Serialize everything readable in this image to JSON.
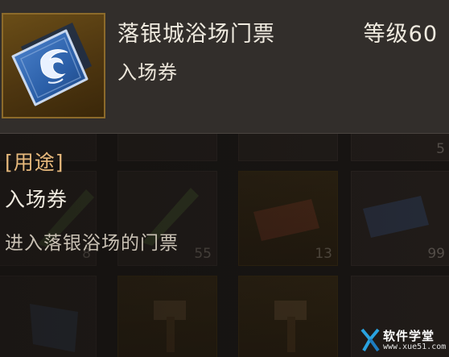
{
  "item": {
    "name": "落银城浴场门票",
    "level": "等级60",
    "subtype": "入场券",
    "icon": "blue-ticket-icon"
  },
  "usage": {
    "header": "[用途]",
    "name": "入场券",
    "description": "进入落银浴场的门票"
  },
  "background_slots": {
    "counts": [
      "5",
      "8",
      "55",
      "13",
      "99"
    ]
  },
  "watermark": {
    "title": "软件学堂",
    "url": "www.xue51.com"
  },
  "colors": {
    "header_bg": "#322e2b",
    "accent_gold": "#e7b97c",
    "text": "#f0ebe0",
    "icon_blue": "#2f5fa8"
  }
}
